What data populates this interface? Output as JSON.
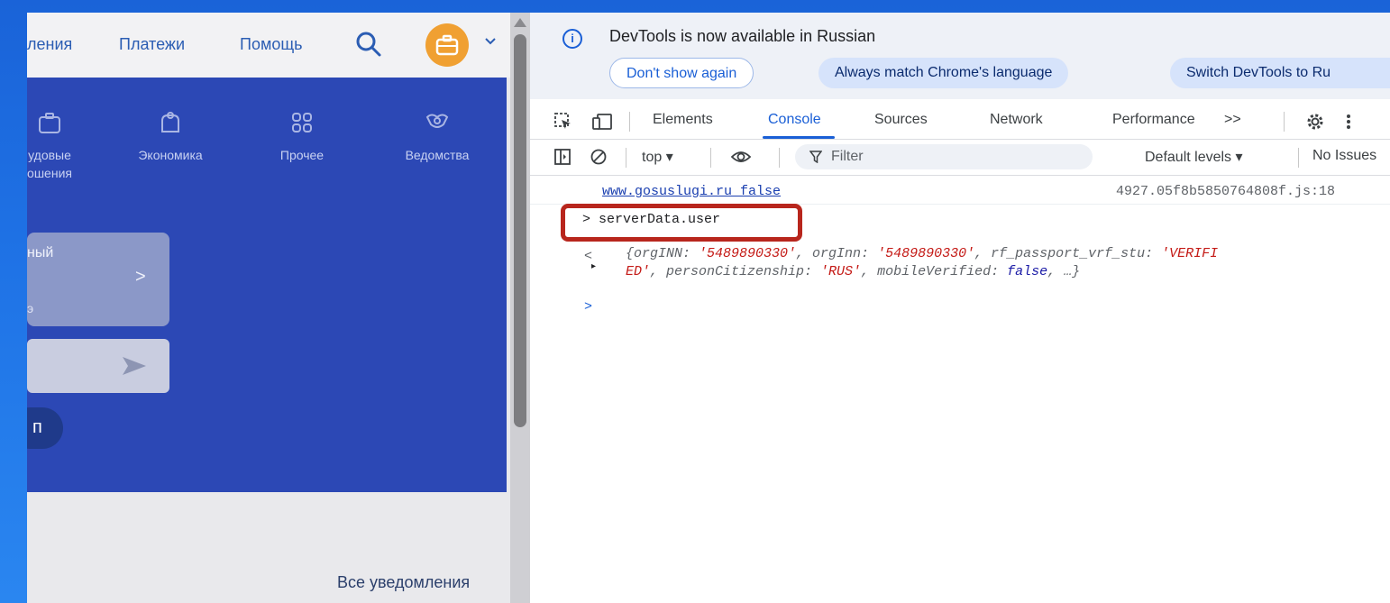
{
  "site": {
    "nav": [
      "ления",
      "Платежи",
      "Помощь"
    ],
    "categories": [
      {
        "icon": "briefcase-icon",
        "label1": "удовые",
        "label2": "ошения"
      },
      {
        "icon": "wallet-icon",
        "label1": "Экономика",
        "label2": ""
      },
      {
        "icon": "grid-icon",
        "label1": "Прочее",
        "label2": ""
      },
      {
        "icon": "emblem-icon",
        "label1": "Ведомства",
        "label2": ""
      }
    ],
    "card_title": "ный",
    "card_arrow": ">",
    "card_sub": "э",
    "chip_label": "п",
    "all_notifications": "Все уведомления"
  },
  "devtools": {
    "info_text": "DevTools is now available in Russian",
    "info_buttons": [
      "Don't show again",
      "Always match Chrome's language",
      "Switch DevTools to Ru"
    ],
    "tabs": [
      "Elements",
      "Console",
      "Sources",
      "Network",
      "Performance"
    ],
    "active_tab": "Console",
    "more_tabs": ">>",
    "context": "top ▾",
    "filter_placeholder": "Filter",
    "levels": "Default levels ▾",
    "issues": "No Issues",
    "log_text": "www.gosuslugi.ru false",
    "log_source": "4927.05f8b5850764808f.js:18",
    "command": "> serverData.user",
    "output_arrow": "<",
    "output_toggle": "▸",
    "output_line1_parts": [
      "{orgINN: ",
      "'5489890330'",
      ", orgInn: ",
      "'5489890330'",
      ", rf_passport_vrf_stu: ",
      "'VERIFI"
    ],
    "output_line2_parts": [
      "ED'",
      ", personCitizenship: ",
      "'RUS'",
      ", mobileVerified: ",
      "false",
      ", …}"
    ],
    "caret": ">"
  },
  "colors": {
    "accent": "#1a5fd6",
    "highlight": "#b8261d",
    "site_blue": "#2c48b5",
    "briefcase_bg": "#f0a032"
  }
}
